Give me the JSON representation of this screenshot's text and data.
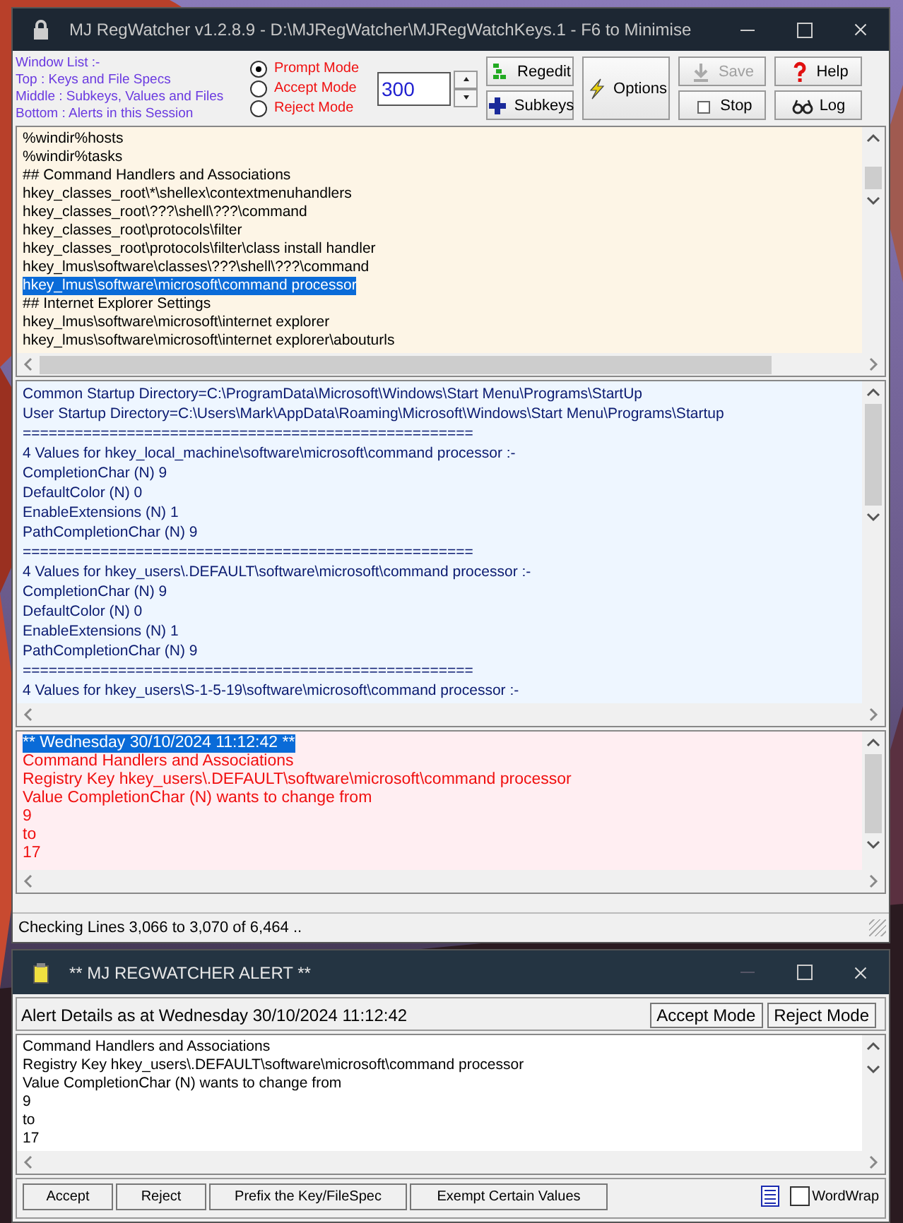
{
  "main_window": {
    "title": "MJ RegWatcher v1.2.8.9 - D:\\MJRegWatcher\\MJRegWatchKeys.1 - F6 to Minimise",
    "legend": [
      "Window List :-",
      "Top : Keys and File Specs",
      "Middle : Subkeys, Values and Files",
      "Bottom : Alerts in this Session"
    ],
    "modes": [
      {
        "label": "Prompt Mode",
        "selected": true
      },
      {
        "label": "Accept Mode",
        "selected": false
      },
      {
        "label": "Reject Mode",
        "selected": false
      }
    ],
    "interval": "300",
    "buttons": [
      {
        "label": "Regedit",
        "kind": "regedit",
        "disabled": false
      },
      {
        "label": "Subkeys",
        "kind": "plus",
        "disabled": false
      },
      {
        "label": "Options",
        "kind": "bolt",
        "disabled": false
      },
      {
        "label": "Save",
        "kind": "save",
        "disabled": true
      },
      {
        "label": "Stop",
        "kind": "stop",
        "disabled": false
      },
      {
        "label": "Help",
        "kind": "help",
        "disabled": false
      },
      {
        "label": "Log",
        "kind": "glasses",
        "disabled": false
      }
    ],
    "keys_list": [
      {
        "text": "%windir%hosts",
        "selected": false
      },
      {
        "text": "%windir%tasks",
        "selected": false
      },
      {
        "text": "## Command Handlers and Associations",
        "selected": false
      },
      {
        "text": "hkey_classes_root\\*\\shellex\\contextmenuhandlers",
        "selected": false
      },
      {
        "text": "hkey_classes_root\\???\\shell\\???\\command",
        "selected": false
      },
      {
        "text": "hkey_classes_root\\protocols\\filter",
        "selected": false
      },
      {
        "text": "hkey_classes_root\\protocols\\filter\\class install handler",
        "selected": false
      },
      {
        "text": "hkey_lmus\\software\\classes\\???\\shell\\???\\command",
        "selected": false
      },
      {
        "text": "hkey_lmus\\software\\microsoft\\command processor",
        "selected": true
      },
      {
        "text": "## Internet Explorer Settings",
        "selected": false
      },
      {
        "text": "hkey_lmus\\software\\microsoft\\internet explorer",
        "selected": false
      },
      {
        "text": "hkey_lmus\\software\\microsoft\\internet explorer\\abouturls",
        "selected": false
      }
    ],
    "values_panel": [
      "Common Startup Directory=C:\\ProgramData\\Microsoft\\Windows\\Start Menu\\Programs\\StartUp",
      "User Startup Directory=C:\\Users\\Mark\\AppData\\Roaming\\Microsoft\\Windows\\Start Menu\\Programs\\Startup",
      "====================================================",
      "4 Values for hkey_local_machine\\software\\microsoft\\command processor :-",
      "CompletionChar (N) 9",
      "DefaultColor (N) 0",
      "EnableExtensions (N) 1",
      "PathCompletionChar (N) 9",
      "====================================================",
      "4 Values for hkey_users\\.DEFAULT\\software\\microsoft\\command processor :-",
      "CompletionChar (N) 9",
      "DefaultColor (N) 0",
      "EnableExtensions (N) 1",
      "PathCompletionChar (N) 9",
      "====================================================",
      "4 Values for hkey_users\\S-1-5-19\\software\\microsoft\\command processor :-"
    ],
    "alerts_panel": [
      {
        "text": "** Wednesday 30/10/2024 11:12:42 **",
        "selected": true
      },
      {
        "text": "Command Handlers and Associations",
        "selected": false
      },
      {
        "text": "Registry Key hkey_users\\.DEFAULT\\software\\microsoft\\command processor",
        "selected": false
      },
      {
        "text": "Value CompletionChar (N) wants to change from",
        "selected": false
      },
      {
        "text": "9",
        "selected": false
      },
      {
        "text": "to",
        "selected": false
      },
      {
        "text": "17",
        "selected": false
      }
    ],
    "status_bar": "Checking Lines 3,066 to 3,070 of 6,464 .."
  },
  "alert_window": {
    "title": "** MJ REGWATCHER ALERT **",
    "details_label": "Alert Details as at Wednesday 30/10/2024 11:12:42",
    "mode_buttons": [
      "Accept Mode",
      "Reject Mode"
    ],
    "details": [
      "Command Handlers and Associations",
      "Registry Key hkey_users\\.DEFAULT\\software\\microsoft\\command processor",
      "Value CompletionChar (N) wants to change from",
      "9",
      "to",
      "17"
    ],
    "buttons": [
      "Accept",
      "Reject",
      "Prefix the Key/FileSpec",
      "Exempt Certain Values"
    ],
    "wordwrap": {
      "label": "WordWrap",
      "checked": false
    }
  }
}
